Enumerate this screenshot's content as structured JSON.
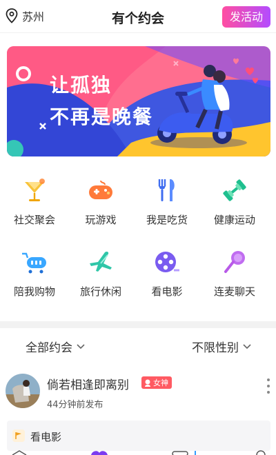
{
  "header": {
    "city": "苏州",
    "title": "有个约会",
    "post_button": "发活动"
  },
  "banner": {
    "line1": "让孤独",
    "line2": "不再是晚餐"
  },
  "categories": [
    {
      "label": "社交聚会",
      "icon": "cocktail-icon"
    },
    {
      "label": "玩游戏",
      "icon": "gamepad-icon"
    },
    {
      "label": "我是吃货",
      "icon": "fork-knife-icon"
    },
    {
      "label": "健康运动",
      "icon": "dumbbell-icon"
    },
    {
      "label": "陪我购物",
      "icon": "shopping-cart-icon"
    },
    {
      "label": "旅行休闲",
      "icon": "airplane-icon"
    },
    {
      "label": "看电影",
      "icon": "film-reel-icon"
    },
    {
      "label": "连麦聊天",
      "icon": "microphone-icon"
    }
  ],
  "filters": {
    "scope": "全部约会",
    "gender": "不限性别"
  },
  "post": {
    "username": "倘若相逢即离别",
    "badge": "女神",
    "time": "44分钟前发布",
    "tag": "看电影"
  },
  "colors": {
    "accent_start": "#ff4ea1",
    "accent_end": "#b34cff",
    "badge": "#ff5a62"
  }
}
